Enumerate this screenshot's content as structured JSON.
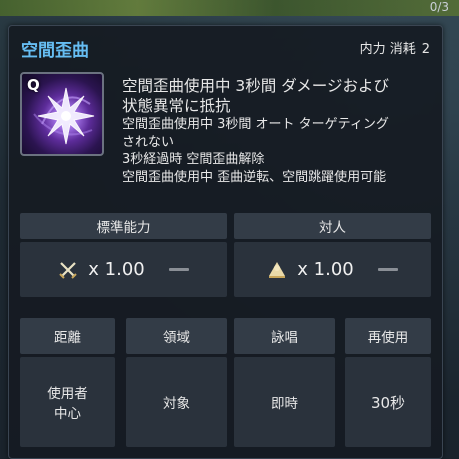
{
  "background": {
    "counter": "0/3"
  },
  "skill": {
    "name": "空間歪曲",
    "cost_label": "内力 消耗",
    "cost_value": "2",
    "hotkey": "Q",
    "icon": "star-burst-icon",
    "description": {
      "headline": [
        "空間歪曲使用中 3秒間 ダメージおよび",
        "状態異常に抵抗"
      ],
      "lines": [
        "空間歪曲使用中 3秒間 オート ターゲティング",
        "されない",
        "3秒経過時 空間歪曲解除",
        "空間歪曲使用中 歪曲逆転、空間跳躍使用可能"
      ]
    }
  },
  "stats": {
    "pve_label": "標準能力",
    "pvp_label": "対人",
    "pve_value": "x 1.00",
    "pvp_value": "x 1.00",
    "pve_icon": "crossed-swords-icon",
    "pvp_icon": "pvp-figure-icon"
  },
  "properties": {
    "headers": [
      "距離",
      "領域",
      "詠唱",
      "再使用"
    ],
    "values": [
      [
        "使用者",
        "中心"
      ],
      "対象",
      "即時",
      "30秒"
    ]
  },
  "colors": {
    "title": "#66bdf2",
    "panel": "#161b22",
    "cell": "#2a323c"
  }
}
